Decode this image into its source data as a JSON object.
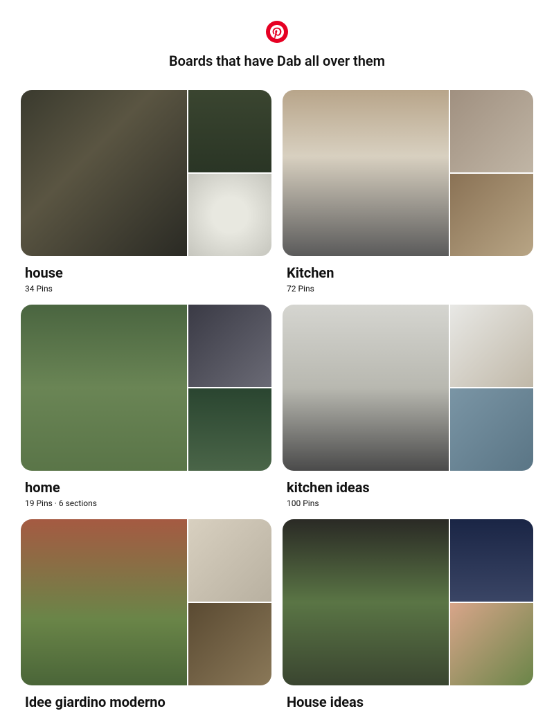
{
  "header": {
    "title": "Boards that have Dab all over them"
  },
  "boards": [
    {
      "name": "house",
      "meta": "34 Pins"
    },
    {
      "name": "Kitchen",
      "meta": "72 Pins"
    },
    {
      "name": "home",
      "meta": "19 Pins · 6 sections"
    },
    {
      "name": "kitchen ideas",
      "meta": "100 Pins"
    },
    {
      "name": "Idee giardino moderno",
      "meta": ""
    },
    {
      "name": "House ideas",
      "meta": ""
    }
  ]
}
